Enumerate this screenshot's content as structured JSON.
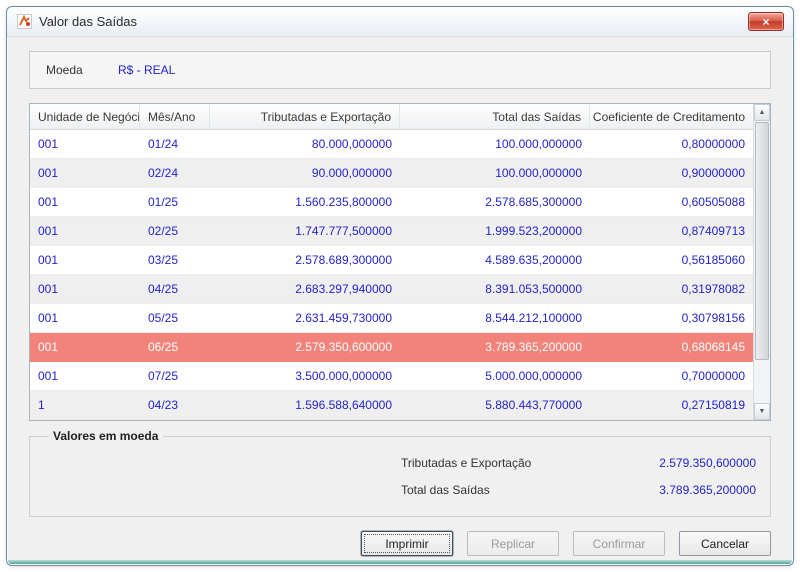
{
  "colors": {
    "value-blue": "#2323c8",
    "selected-bg": "#f2837b",
    "selected-text": "#ffffff"
  },
  "window": {
    "title": "Valor das Saídas",
    "close_glyph": "×"
  },
  "moeda": {
    "label": "Moeda",
    "value": "R$ - REAL"
  },
  "table": {
    "columns": [
      "Unidade de Negócio",
      "Mês/Ano",
      "Tributadas e Exportação",
      "Total das Saídas",
      "Coeficiente de Creditamento"
    ],
    "selected_index": 7,
    "rows": [
      [
        "001",
        "01/24",
        "80.000,000000",
        "100.000,000000",
        "0,80000000"
      ],
      [
        "001",
        "02/24",
        "90.000,000000",
        "100.000,000000",
        "0,90000000"
      ],
      [
        "001",
        "01/25",
        "1.560.235,800000",
        "2.578.685,300000",
        "0,60505088"
      ],
      [
        "001",
        "02/25",
        "1.747.777,500000",
        "1.999.523,200000",
        "0,87409713"
      ],
      [
        "001",
        "03/25",
        "2.578.689,300000",
        "4.589.635,200000",
        "0,56185060"
      ],
      [
        "001",
        "04/25",
        "2.683.297,940000",
        "8.391.053,500000",
        "0,31978082"
      ],
      [
        "001",
        "05/25",
        "2.631.459,730000",
        "8.544.212,100000",
        "0,30798156"
      ],
      [
        "001",
        "06/25",
        "2.579.350,600000",
        "3.789.365,200000",
        "0,68068145"
      ],
      [
        "001",
        "07/25",
        "3.500.000,000000",
        "5.000.000,000000",
        "0,70000000"
      ],
      [
        "1",
        "04/23",
        "1.596.588,640000",
        "5.880.443,770000",
        "0,27150819"
      ]
    ]
  },
  "scrollbar": {
    "up_glyph": "▲",
    "down_glyph": "▼"
  },
  "summary": {
    "title": "Valores em moeda",
    "items": [
      {
        "label": "Tributadas e Exportação",
        "value": "2.579.350,600000"
      },
      {
        "label": "Total das Saídas",
        "value": "3.789.365,200000"
      }
    ]
  },
  "buttons": [
    {
      "label": "Imprimir",
      "enabled": true,
      "default": true
    },
    {
      "label": "Replicar",
      "enabled": false,
      "default": false
    },
    {
      "label": "Confirmar",
      "enabled": false,
      "default": false
    },
    {
      "label": "Cancelar",
      "enabled": true,
      "default": false
    }
  ]
}
